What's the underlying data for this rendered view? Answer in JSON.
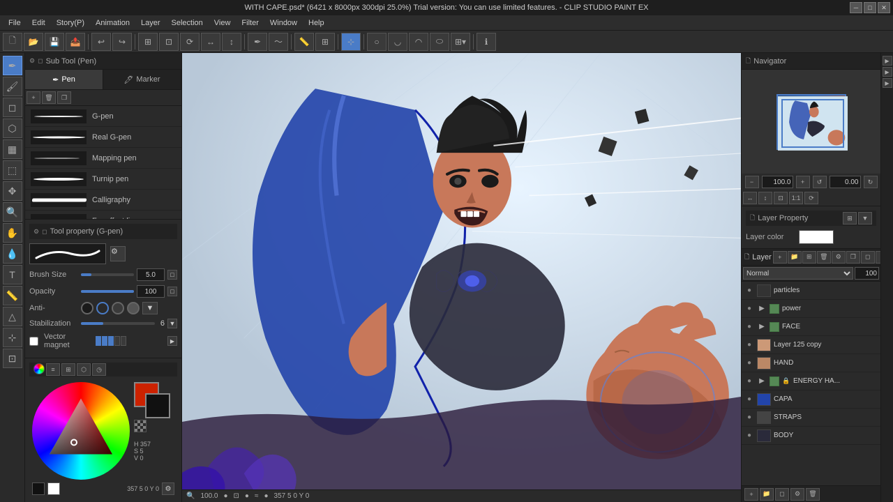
{
  "titleBar": {
    "title": "WITH CAPE.psd* (6421 x 8000px 300dpi 25.0%)  Trial version: You can use limited features. - CLIP STUDIO PAINT EX"
  },
  "menuBar": {
    "items": [
      "File",
      "Edit",
      "Story(P)",
      "Animation",
      "Layer",
      "Selection",
      "View",
      "Filter",
      "Window",
      "Help"
    ]
  },
  "subToolPanel": {
    "header": "Sub Tool (Pen)",
    "tabs": [
      {
        "label": "Pen",
        "active": true
      },
      {
        "label": "Marker",
        "active": false
      }
    ],
    "brushes": [
      {
        "name": "G-pen"
      },
      {
        "name": "Real G-pen"
      },
      {
        "name": "Mapping pen"
      },
      {
        "name": "Turnip pen"
      },
      {
        "name": "Calligraphy"
      },
      {
        "name": "For effect line"
      }
    ]
  },
  "toolProperty": {
    "header": "Tool property (G-pen)",
    "toolName": "G-pen",
    "brushSize": {
      "label": "Brush Size",
      "value": "5.0"
    },
    "opacity": {
      "label": "Opacity",
      "value": "100"
    },
    "antiAlias": {
      "label": "Anti-"
    },
    "stabilization": {
      "label": "Stabilization",
      "value": "6"
    },
    "vectorMagnet": {
      "label": "Vector magnet"
    }
  },
  "colorPanel": {
    "values": {
      "h": "357",
      "s": "5",
      "v": "0",
      "brightness": "0"
    }
  },
  "navigator": {
    "header": "Navigator",
    "zoom": "100.0",
    "rotation": "0.00"
  },
  "layerProperty": {
    "header": "Layer Property",
    "layerColor": {
      "label": "Layer color",
      "value": "#ffffff"
    }
  },
  "layers": {
    "header": "Layer",
    "items": [
      {
        "name": "particles",
        "type": "layer",
        "visible": true,
        "locked": false
      },
      {
        "name": "power",
        "type": "folder",
        "visible": true,
        "locked": false
      },
      {
        "name": "FACE",
        "type": "folder",
        "visible": true,
        "locked": false
      },
      {
        "name": "Layer 125 copy",
        "type": "layer",
        "visible": true,
        "locked": false
      },
      {
        "name": "HAND",
        "type": "layer",
        "visible": true,
        "locked": false
      },
      {
        "name": "ENERGY HA...",
        "type": "folder",
        "visible": true,
        "locked": false
      },
      {
        "name": "CAPA",
        "type": "layer",
        "visible": true,
        "locked": false
      },
      {
        "name": "STRAPS",
        "type": "layer",
        "visible": true,
        "locked": false
      },
      {
        "name": "BODY",
        "type": "layer",
        "visible": true,
        "locked": false
      }
    ]
  },
  "statusBar": {
    "zoom": "100.0",
    "coords": "357 5   0 Y   0"
  },
  "icons": {
    "eye": "👁",
    "folder": "📁",
    "layer": "◻",
    "lock": "🔒",
    "pen": "✒",
    "marker": "🖊",
    "move": "✥",
    "select": "⬚",
    "lasso": "⬤",
    "fill": "⬡",
    "eraser": "◻",
    "eyedropper": "💧",
    "zoom": "🔍",
    "hand": "✋",
    "text": "T",
    "shape": "△",
    "gradient": "▦",
    "ruler": "📏",
    "close": "✕",
    "minimize": "─",
    "maximize": "□",
    "search": "🔍",
    "gear": "⚙",
    "add": "+",
    "trash": "🗑",
    "copy": "❐",
    "chevronRight": "▶",
    "chevronDown": "▼",
    "chevronLeft": "◀",
    "visible": "●"
  }
}
